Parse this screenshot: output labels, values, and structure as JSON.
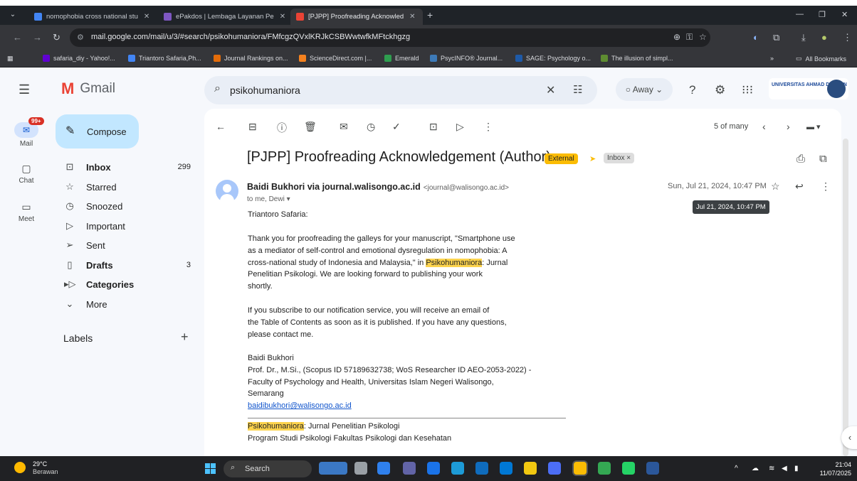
{
  "tabs": [
    {
      "title": "nomophobia cross national stu",
      "close": "✕"
    },
    {
      "title": "ePakdos | Lembaga Layanan Pe",
      "close": "✕"
    },
    {
      "title": "[PJPP] Proofreading Acknowled",
      "close": "✕"
    }
  ],
  "window_controls": {
    "minimize": "—",
    "restore": "❐",
    "close": "✕"
  },
  "address_bar": {
    "url": "mail.google.com/mail/u/3/#search/psikohumaniora/FMfcgzQVxlKRJkCSBWwtwfkMFtckhgzg"
  },
  "bookmarks": {
    "items": [
      "safaria_diy - Yahoo!...",
      "Triantoro Safaria,Ph...",
      "Journal Rankings on...",
      "ScienceDirect.com |...",
      "Emerald",
      "PsycINFO® Journal...",
      "SAGE: Psychology o...",
      "The illusion of simpl..."
    ],
    "more": "»",
    "all_bookmarks": "All Bookmarks"
  },
  "gmail": {
    "logo_text": "Gmail",
    "search": {
      "query": "psikohumaniora"
    },
    "status_label": "Away",
    "org_name": "UNIVERSITAS AHMAD DAHLAN",
    "rail": {
      "mail_label": "Mail",
      "mail_badge": "99+",
      "chat_label": "Chat",
      "meet_label": "Meet"
    },
    "compose_label": "Compose",
    "nav": [
      {
        "label": "Inbox",
        "count": "299",
        "icon": "inbox-icon"
      },
      {
        "label": "Starred",
        "count": "",
        "icon": "star-icon"
      },
      {
        "label": "Snoozed",
        "count": "",
        "icon": "clock-icon"
      },
      {
        "label": "Important",
        "count": "",
        "icon": "important-icon"
      },
      {
        "label": "Sent",
        "count": "",
        "icon": "send-icon"
      },
      {
        "label": "Drafts",
        "count": "3",
        "icon": "draft-icon"
      },
      {
        "label": "Categories",
        "count": "",
        "icon": "label-icon"
      },
      {
        "label": "More",
        "count": "",
        "icon": "chevron-down-icon"
      }
    ],
    "labels_heading": "Labels"
  },
  "email": {
    "page_count": "5 of many",
    "subject": "[PJPP] Proofreading Acknowledgement (Author)",
    "external_chip": "External",
    "inbox_chip": "Inbox ×",
    "sender_name": "Baidi Bukhori via journal.walisongo.ac.id",
    "sender_email": "<journal@walisongo.ac.id>",
    "recipients": "to me, Dewi ▾",
    "date": "Sun, Jul 21, 2024, 10:47 PM",
    "tooltip": "Jul 21, 2024, 10:47 PM",
    "greeting": "Triantoro Safaria:",
    "para1_l1": "Thank you for proofreading the galleys for your manuscript, \"Smartphone use",
    "para1_l2": "as a mediator of self-control and emotional dysregulation in nomophobia: A",
    "para1_l3a": "cross-national study of Indonesia and Malaysia,\" in ",
    "highlight": "Psikohumaniora",
    "para1_l3b": ": Jurnal",
    "para1_l4": "Penelitian Psikologi. We are looking forward to publishing your work",
    "para1_l5": "shortly.",
    "para2_l1": "If you subscribe to our notification service, you will receive an email of",
    "para2_l2": "the Table of Contents as soon as it is published. If you have any questions,",
    "para2_l3": "please contact me.",
    "sig_name": "Baidi Bukhori",
    "sig_title": "Prof. Dr., M.Si., (Scopus ID 57189632738; WoS Researcher ID AEO-2053-2022) -",
    "sig_faculty": "Faculty of Psychology and Health, Universitas Islam Negeri Walisongo,",
    "sig_city": "Semarang",
    "sig_email": "baidibukhori@walisongo.ac.id",
    "footer_journal_tail": ": Jurnal Penelitian Psikologi",
    "footer_program": "Program Studi Psikologi Fakultas Psikologi dan Kesehatan"
  },
  "taskbar": {
    "weather_temp": "29°C",
    "weather_cond": "Berawan",
    "search_label": "Search",
    "time": "21:04",
    "date": "11/07/2025"
  },
  "colors": {
    "accent_blue": "#0b57d0",
    "gmail_red": "#ea4335",
    "external_chip": "#fbbc04",
    "highlight": "#fcd34d"
  }
}
